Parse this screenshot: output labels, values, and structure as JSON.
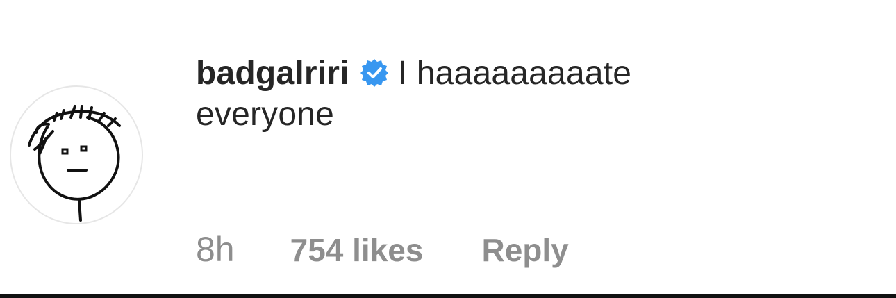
{
  "comment": {
    "username": "badgalriri",
    "verified_icon": "verified-badge-icon",
    "text_line1": "I haaaaaaaaate",
    "text_line2": "everyone",
    "time": "8h",
    "likes": "754 likes",
    "reply_label": "Reply"
  },
  "colors": {
    "text": "#262626",
    "muted": "#8e8e8e",
    "verified": "#3897f0"
  }
}
